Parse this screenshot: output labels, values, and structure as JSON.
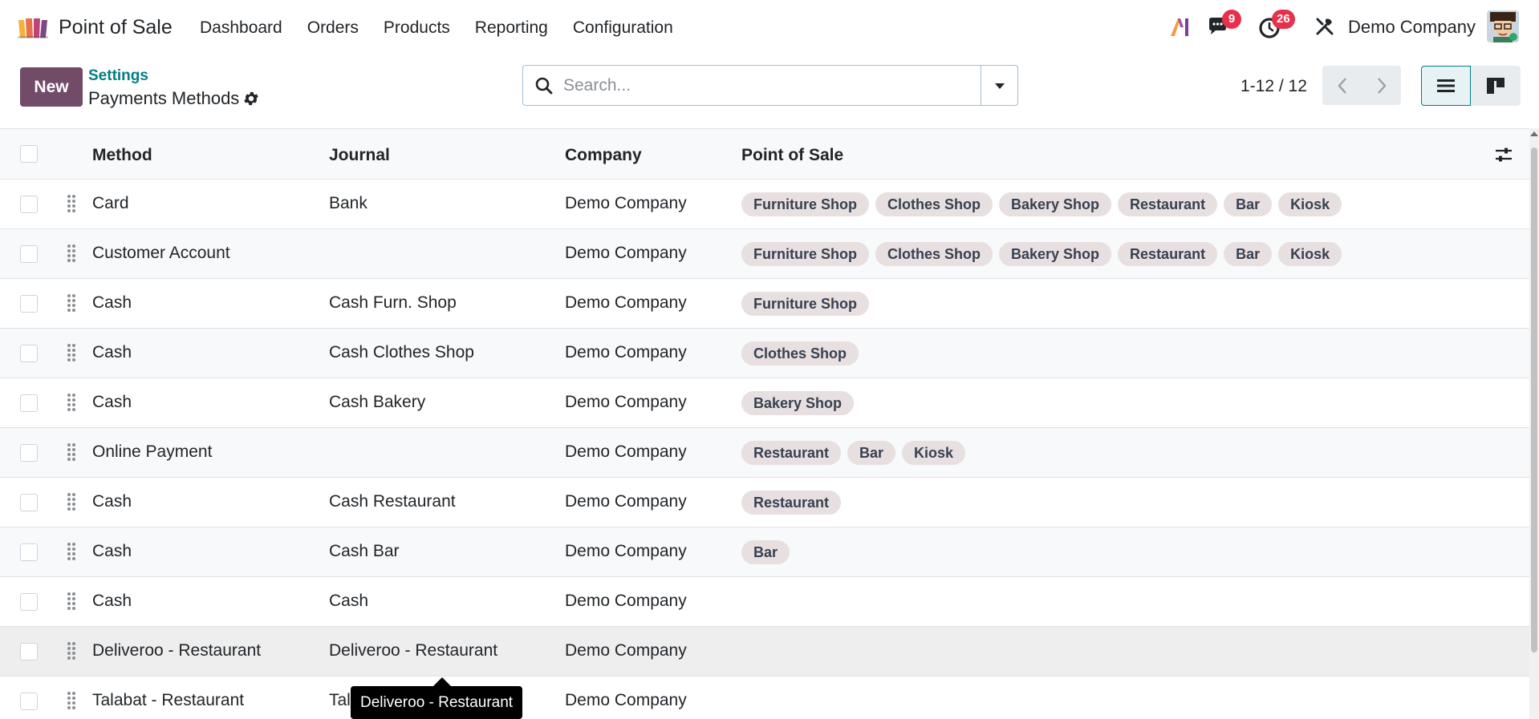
{
  "navbar": {
    "app_name": "Point of Sale",
    "menu": [
      "Dashboard",
      "Orders",
      "Products",
      "Reporting",
      "Configuration"
    ],
    "chat_badge": "9",
    "activity_badge": "26",
    "company": "Demo Company"
  },
  "control_panel": {
    "new_label": "New",
    "breadcrumb_parent": "Settings",
    "breadcrumb_current": "Payments Methods",
    "search_placeholder": "Search...",
    "pager": "1-12 / 12"
  },
  "table": {
    "headers": {
      "method": "Method",
      "journal": "Journal",
      "company": "Company",
      "point_of_sale": "Point of Sale"
    },
    "rows": [
      {
        "method": "Card",
        "journal": "Bank",
        "company": "Demo Company",
        "pos": [
          "Furniture Shop",
          "Clothes Shop",
          "Bakery Shop",
          "Restaurant",
          "Bar",
          "Kiosk"
        ]
      },
      {
        "method": "Customer Account",
        "journal": "",
        "company": "Demo Company",
        "pos": [
          "Furniture Shop",
          "Clothes Shop",
          "Bakery Shop",
          "Restaurant",
          "Bar",
          "Kiosk"
        ]
      },
      {
        "method": "Cash",
        "journal": "Cash Furn. Shop",
        "company": "Demo Company",
        "pos": [
          "Furniture Shop"
        ]
      },
      {
        "method": "Cash",
        "journal": "Cash Clothes Shop",
        "company": "Demo Company",
        "pos": [
          "Clothes Shop"
        ]
      },
      {
        "method": "Cash",
        "journal": "Cash Bakery",
        "company": "Demo Company",
        "pos": [
          "Bakery Shop"
        ]
      },
      {
        "method": "Online Payment",
        "journal": "",
        "company": "Demo Company",
        "pos": [
          "Restaurant",
          "Bar",
          "Kiosk"
        ]
      },
      {
        "method": "Cash",
        "journal": "Cash Restaurant",
        "company": "Demo Company",
        "pos": [
          "Restaurant"
        ]
      },
      {
        "method": "Cash",
        "journal": "Cash Bar",
        "company": "Demo Company",
        "pos": [
          "Bar"
        ]
      },
      {
        "method": "Cash",
        "journal": "Cash",
        "company": "Demo Company",
        "pos": []
      },
      {
        "method": "Deliveroo - Restaurant",
        "journal": "Deliveroo - Restaurant",
        "company": "Demo Company",
        "pos": []
      },
      {
        "method": "Talabat - Restaurant",
        "journal": "Tal",
        "company": "Demo Company",
        "pos": []
      }
    ]
  },
  "tooltip": "Deliveroo - Restaurant",
  "colors": {
    "primary": "#714b67",
    "link": "#017e84",
    "badge": "#e8304a",
    "tag_bg": "#e7dfe0"
  },
  "icons": {
    "app_logo": "pos-app-icon",
    "ai": "ai-icon",
    "chat": "chat-icon",
    "activity": "clock-icon",
    "debug": "tools-icon",
    "settings": "gear-icon",
    "search": "search-icon",
    "dropdown": "caret-down-icon",
    "prev": "chevron-left-icon",
    "next": "chevron-right-icon",
    "list_view": "list-view-icon",
    "kanban_view": "kanban-view-icon",
    "optional_columns": "sliders-icon",
    "drag_handle": "drag-handle-icon"
  }
}
